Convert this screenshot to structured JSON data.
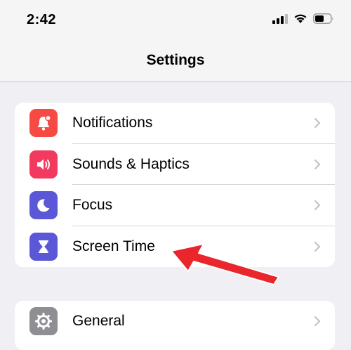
{
  "status_bar": {
    "time": "2:42",
    "icons": [
      "cellular-signal-icon",
      "wifi-icon",
      "battery-icon"
    ]
  },
  "nav": {
    "title": "Settings"
  },
  "groups": [
    {
      "items": [
        {
          "label": "Notifications",
          "icon": "bell-icon",
          "color": "#f74a45"
        },
        {
          "label": "Sounds & Haptics",
          "icon": "speaker-icon",
          "color": "#f2395f"
        },
        {
          "label": "Focus",
          "icon": "moon-icon",
          "color": "#5a58d6"
        },
        {
          "label": "Screen Time",
          "icon": "hourglass-icon",
          "color": "#5a58d6"
        }
      ]
    },
    {
      "items": [
        {
          "label": "General",
          "icon": "gear-icon",
          "color": "#8e8e93"
        }
      ]
    }
  ],
  "annotation": {
    "type": "red-arrow",
    "color": "#e8262b",
    "target": "Screen Time"
  }
}
